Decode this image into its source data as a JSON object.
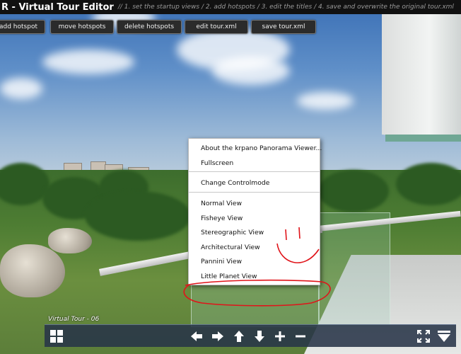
{
  "titlebar": {
    "title": "R - Virtual Tour Editor",
    "steps": "// 1. set the startup views / 2. add hotspots / 3. edit the titles / 4. save and overwrite the original tour.xml"
  },
  "toolbar": {
    "buttons": [
      {
        "label": "add hotspot"
      },
      {
        "label": "move hotspots"
      },
      {
        "label": "delete hotspots"
      },
      {
        "label": "edit tour.xml"
      },
      {
        "label": "save tour.xml"
      }
    ]
  },
  "context_menu": {
    "items": [
      "About the krpano Panorama Viewer...",
      "Fullscreen",
      "Change Controlmode",
      "Normal View",
      "Fisheye View",
      "Stereographic View",
      "Architectural View",
      "Pannini View",
      "Little Planet View"
    ]
  },
  "annotation": {
    "color": "#e0141a",
    "highlighted_item": "Little Planet View"
  },
  "tour": {
    "label": "Virtual Tour - 06"
  },
  "bottom_bar": {
    "icons": [
      "thumbnails-icon",
      "arrow-left-icon",
      "arrow-right-icon",
      "arrow-up-icon",
      "arrow-down-icon",
      "zoom-in-icon",
      "zoom-out-icon",
      "fullscreen-icon",
      "hide-controls-icon"
    ]
  },
  "colors": {
    "title_bg": "#111111",
    "button_bg": "#2b2b2b",
    "bottom_bar_bg": "#283448"
  }
}
